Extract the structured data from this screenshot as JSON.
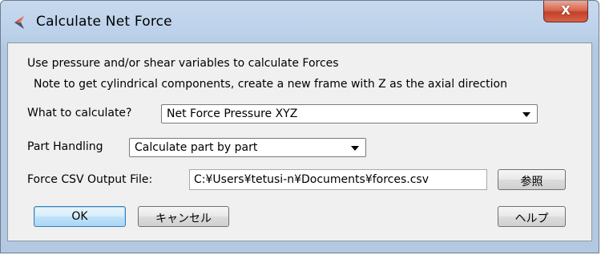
{
  "window": {
    "title": "Calculate Net Force",
    "close_glyph": "X",
    "app_icon": "app-logo-icon",
    "accent_color": "#bcd1ea",
    "close_color": "#c4402a"
  },
  "info": {
    "line1": "Use pressure and/or shear variables to calculate Forces",
    "line2": "Note to get cylindrical components, create a new frame with Z as the axial direction"
  },
  "what_to_calculate": {
    "label": "What to calculate?",
    "selected": "Net Force Pressure XYZ"
  },
  "part_handling": {
    "label": "Part Handling",
    "selected": "Calculate part by part"
  },
  "output_file": {
    "label": "Force CSV Output File:",
    "value": "C:¥Users¥tetusi-n¥Documents¥forces.csv",
    "browse_label": "参照"
  },
  "buttons": {
    "ok": "OK",
    "cancel": "キャンセル",
    "help": "ヘルプ"
  }
}
